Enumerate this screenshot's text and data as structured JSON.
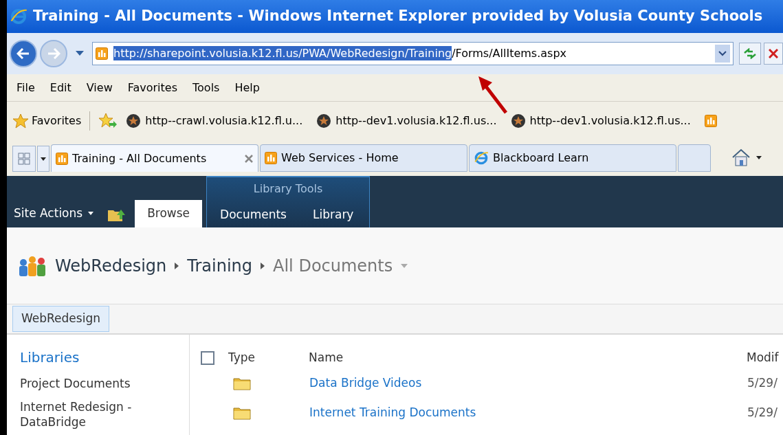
{
  "window": {
    "title": "Training - All Documents - Windows Internet Explorer provided by Volusia County Schools"
  },
  "address_bar": {
    "selected_text": "http://sharepoint.volusia.k12.fl.us/PWA/WebRedesign/Training",
    "rest_text": "/Forms/AllItems.aspx"
  },
  "menu_bar": [
    "File",
    "Edit",
    "View",
    "Favorites",
    "Tools",
    "Help"
  ],
  "favorites_bar": {
    "label": "Favorites",
    "links": [
      "http--crawl.volusia.k12.fl.u...",
      "http--dev1.volusia.k12.fl.us...",
      "http--dev1.volusia.k12.fl.us..."
    ]
  },
  "tabs": [
    {
      "label": "Training - All Documents",
      "selected": true,
      "kind": "site"
    },
    {
      "label": "Web Services - Home",
      "selected": false,
      "kind": "site"
    },
    {
      "label": "Blackboard Learn",
      "selected": false,
      "kind": "ie"
    }
  ],
  "ribbon": {
    "site_actions": "Site Actions",
    "group_label": "Library Tools",
    "tabs": [
      {
        "label": "Browse",
        "selected": true
      },
      {
        "label": "Documents",
        "selected": false
      },
      {
        "label": "Library",
        "selected": false
      }
    ]
  },
  "breadcrumb": [
    "WebRedesign",
    "Training",
    "All Documents"
  ],
  "top_nav": [
    {
      "label": "WebRedesign",
      "selected": true
    }
  ],
  "quick_launch": {
    "heading": "Libraries",
    "items": [
      "Project Documents",
      "Internet Redesign - DataBridge"
    ]
  },
  "list": {
    "select_all_checked": false,
    "columns": [
      "Type",
      "Name",
      "Modif"
    ],
    "rows": [
      {
        "name": "Data Bridge Videos",
        "modified": "5/29/"
      },
      {
        "name": "Internet Training Documents",
        "modified": "5/29/"
      }
    ]
  }
}
